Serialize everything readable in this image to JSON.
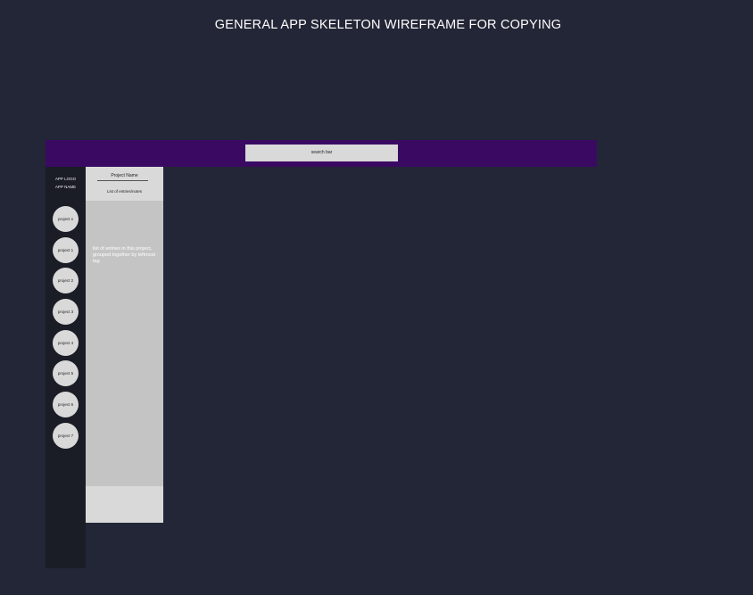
{
  "page": {
    "title": "GENERAL APP SKELETON WIREFRAME FOR COPYING"
  },
  "topbar": {
    "search_label": "search bar"
  },
  "sidebar": {
    "app_logo": "APP LOGO",
    "app_name": "APP NAME",
    "projects": [
      {
        "label": "project x"
      },
      {
        "label": "project 1"
      },
      {
        "label": "project 2"
      },
      {
        "label": "project 3"
      },
      {
        "label": "project 4"
      },
      {
        "label": "project 5"
      },
      {
        "label": "project 6"
      },
      {
        "label": "project 7"
      }
    ]
  },
  "panel": {
    "project_name": "Project Name",
    "list_label": "List of entries/notes",
    "entries_text": "list of entries in this project, grouped together by leftmost tag"
  },
  "colors": {
    "background": "#232636",
    "topbar": "#3a0a63",
    "sidebar": "#1a1c26",
    "panel": "#d9d9d9",
    "entries_area": "#c4c4c4"
  }
}
